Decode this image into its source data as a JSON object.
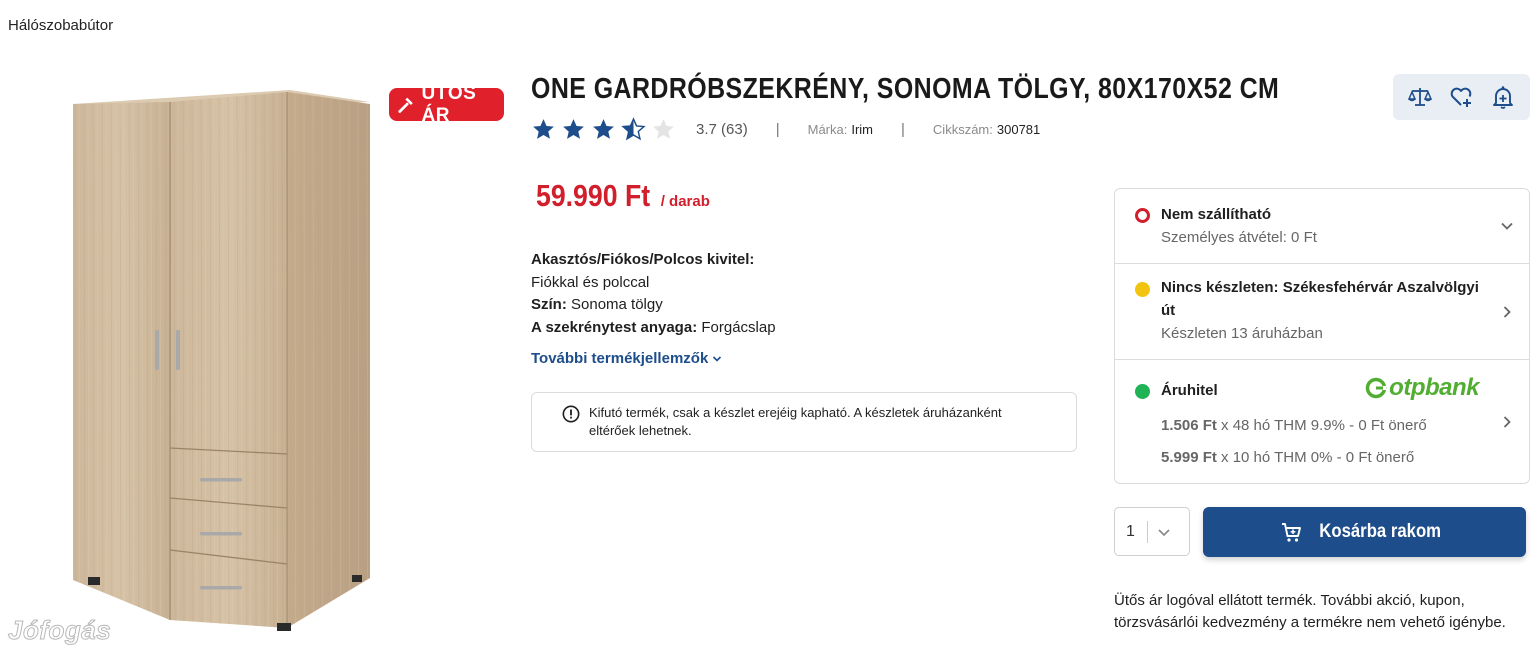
{
  "breadcrumb": "Hálószobabútor",
  "badge": {
    "label": "ÜTŐS ÁR",
    "color": "#e0202a",
    "icon": "hammer-icon"
  },
  "watermark": "Jófogás",
  "product": {
    "title": "ONE GARDRÓBSZEKRÉNY, SONOMA TÖLGY, 80X170X52 CM",
    "rating_value": 3.7,
    "rating_text": "3.7 (63)",
    "brand_label": "Márka:",
    "brand": "Irim",
    "sku_label": "Cikkszám:",
    "sku": "300781",
    "price": "59.990 Ft",
    "price_unit": "/ darab",
    "price_color": "#d21f2c"
  },
  "specs": [
    {
      "label": "Akasztós/Fiókos/Polcos kivitel:",
      "value": "Fiókkal és polccal"
    },
    {
      "label": "Szín:",
      "value": "Sonoma tölgy"
    },
    {
      "label": "A szekrénytest anyaga:",
      "value": "Forgácslap"
    }
  ],
  "more_link": "További termékjellemzők",
  "notice": "Kifutó termék, csak a készlet erejéig kapható. A készletek áruházanként eltérőek lehetnek.",
  "actions": [
    "compare-icon",
    "heart-plus-icon",
    "bell-plus-icon"
  ],
  "availability": {
    "delivery": {
      "title": "Nem szállítható",
      "sub": "Személyes átvétel: 0 Ft",
      "status_color": "#d21f2c"
    },
    "stock": {
      "title_line1": "Nincs készleten: Székesfehérvár Aszalvölgyi",
      "title_line2": "út",
      "sub": "Készleten 13 áruházban",
      "status_color": "#f2c40f"
    },
    "credit": {
      "title": "Áruhitel",
      "status_color": "#1fb356",
      "bank": "otpbank",
      "line1_amount": "1.506 Ft",
      "line1_rest": " x 48 hó THM 9.9% - 0 Ft önerő",
      "line2_amount": "5.999 Ft",
      "line2_rest": " x 10 hó THM 0% - 0 Ft önerő"
    }
  },
  "cart": {
    "quantity": "1",
    "button_label": "Kosárba rakom",
    "button_color": "#1d4d8a"
  },
  "disclaimer": "Ütős ár logóval ellátott termék. További akció, kupon, törzsvásárlói kedvezmény a termékre nem vehető igénybe."
}
